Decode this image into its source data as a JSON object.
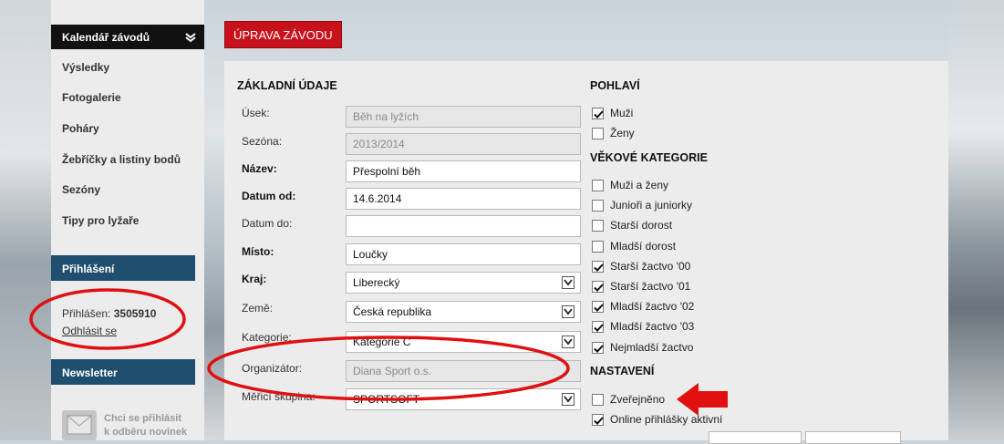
{
  "sidebar": {
    "active_item": "Kalendář závodů",
    "items": [
      "Výsledky",
      "Fotogalerie",
      "Poháry",
      "Žebříčky a listiny bodů",
      "Sezóny",
      "Tipy pro lyžaře"
    ],
    "login_header": "Přihlášení",
    "logged_in_label": "Přihlášen:",
    "logged_in_user": "3505910",
    "logout_label": "Odhlásit se",
    "newsletter_header": "Newsletter",
    "newsletter_line1": "Chci se přihlásit",
    "newsletter_line2": "k odběru novinek"
  },
  "main": {
    "title_button": "ÚPRAVA ZÁVODU",
    "basic_header": "ZÁKLADNÍ ÚDAJE",
    "fields": {
      "usek": {
        "label": "Úsek:",
        "value": "Běh na lyžích"
      },
      "sezona": {
        "label": "Sezóna:",
        "value": "2013/2014"
      },
      "nazev": {
        "label": "Název:",
        "value": "Přespolní běh"
      },
      "datum_od": {
        "label": "Datum od:",
        "value": "14.6.2014"
      },
      "datum_do": {
        "label": "Datum do:",
        "value": ""
      },
      "misto": {
        "label": "Místo:",
        "value": "Loučky"
      },
      "kraj": {
        "label": "Kraj:",
        "value": "Liberecký"
      },
      "zeme": {
        "label": "Země:",
        "value": "Česká republika"
      },
      "kategorie": {
        "label": "Kategorie:",
        "value": "Kategorie C"
      },
      "organizator": {
        "label": "Organizátor:",
        "value": "Diana Sport o.s."
      },
      "skupina": {
        "label": "Měřicí skupina:",
        "value": "SPORTSOFT"
      }
    }
  },
  "gender": {
    "header": "POHLAVÍ",
    "items": [
      {
        "label": "Muži",
        "checked": true
      },
      {
        "label": "Ženy",
        "checked": false
      }
    ]
  },
  "age": {
    "header": "VĚKOVÉ KATEGORIE",
    "items": [
      {
        "label": "Muži a ženy",
        "checked": false
      },
      {
        "label": "Junioři a juniorky",
        "checked": false
      },
      {
        "label": "Starší dorost",
        "checked": false
      },
      {
        "label": "Mladší dorost",
        "checked": false
      },
      {
        "label": "Starší žactvo '00",
        "checked": true
      },
      {
        "label": "Starší žactvo '01",
        "checked": true
      },
      {
        "label": "Mladší žactvo '02",
        "checked": true
      },
      {
        "label": "Mladší žactvo '03",
        "checked": true
      },
      {
        "label": "Nejmladší žactvo",
        "checked": true
      }
    ]
  },
  "settings": {
    "header": "NASTAVENÍ",
    "items": [
      {
        "label": "Zveřejněno",
        "checked": false
      },
      {
        "label": "Online přihlášky aktivní",
        "checked": true
      }
    ]
  },
  "colors": {
    "accent_red": "#c8111b",
    "sidebar_header": "#1f4e6e",
    "annotation_red": "#e01010"
  }
}
